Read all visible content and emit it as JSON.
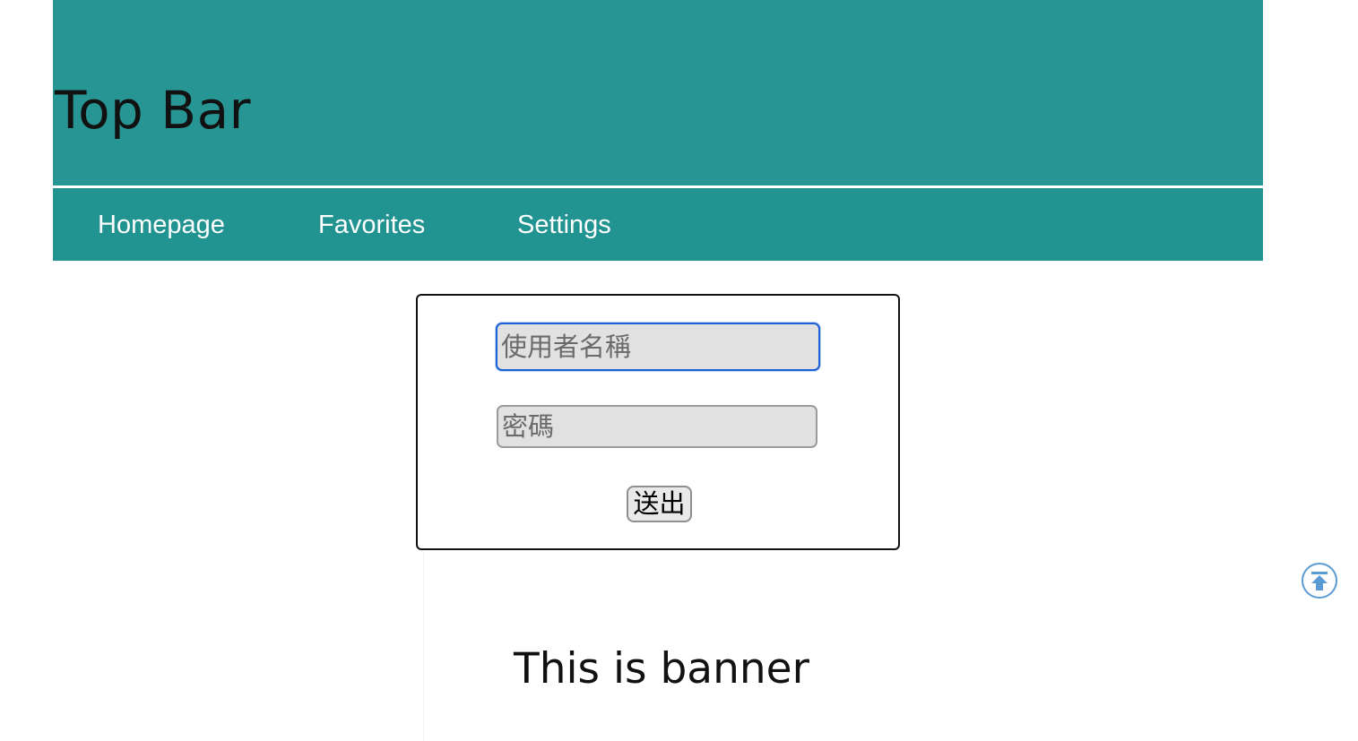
{
  "header": {
    "title": "Top Bar"
  },
  "nav": {
    "items": [
      {
        "label": "Homepage"
      },
      {
        "label": "Favorites"
      },
      {
        "label": "Settings"
      }
    ]
  },
  "login_form": {
    "username_placeholder": "使用者名稱",
    "username_value": "",
    "password_placeholder": "密碼",
    "password_value": "",
    "submit_label": "送出"
  },
  "banner": {
    "text": "This is banner"
  },
  "scroll_top": {
    "icon": "arrow-up-to-top-icon"
  },
  "colors": {
    "top_bar": "#279593",
    "nav_bar": "#219390",
    "focus_border": "#1c62d6",
    "scroll_icon": "#5b9bd5"
  }
}
